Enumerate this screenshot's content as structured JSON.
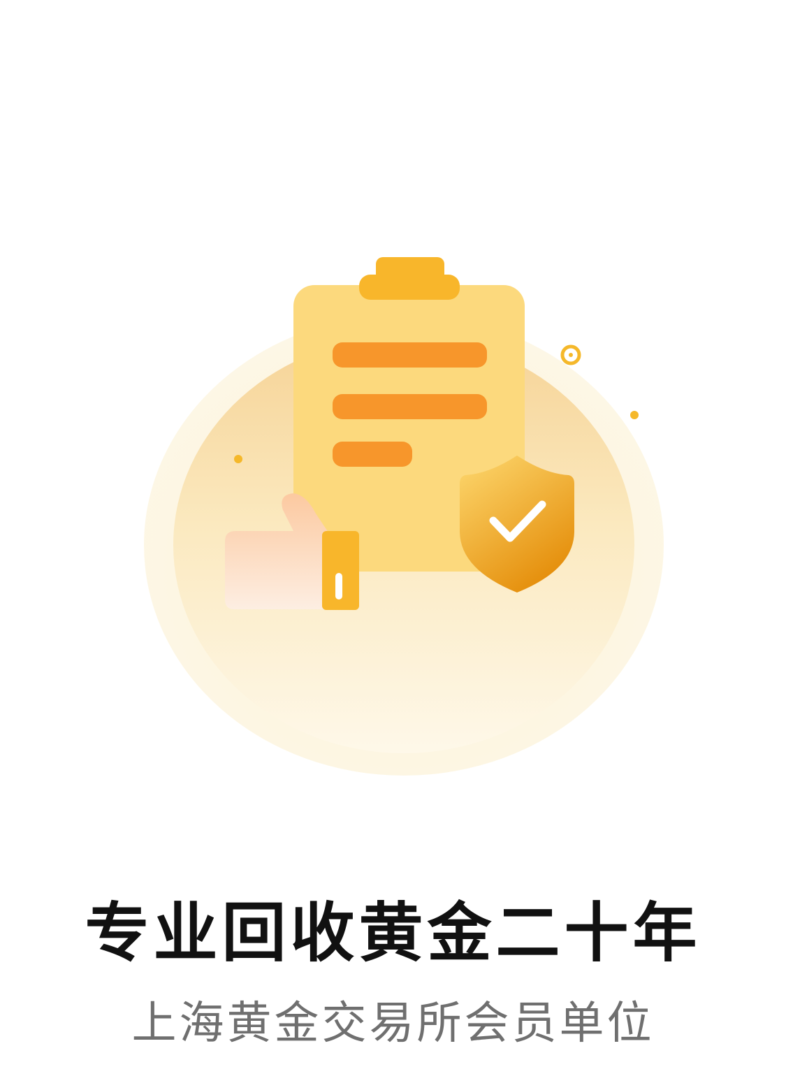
{
  "content": {
    "title": "专业回收黄金二十年",
    "subtitle": "上海黄金交易所会员单位"
  },
  "illustration": {
    "icons": [
      "clipboard-icon",
      "shield-check-icon",
      "thumbs-up-icon"
    ]
  },
  "colors": {
    "background": "#ffffff",
    "circle_outer": "#fdf5dc",
    "circle_inner_top": "#f6d9a0",
    "clipboard": "#fcd97d",
    "clipboard_clip": "#f8b62b",
    "lines": "#f7962b",
    "shield_top": "#fcd56b",
    "shield_bottom": "#e7960f",
    "cuff": "#f8b62b",
    "title": "#111111",
    "subtitle": "#6f6f6f"
  }
}
